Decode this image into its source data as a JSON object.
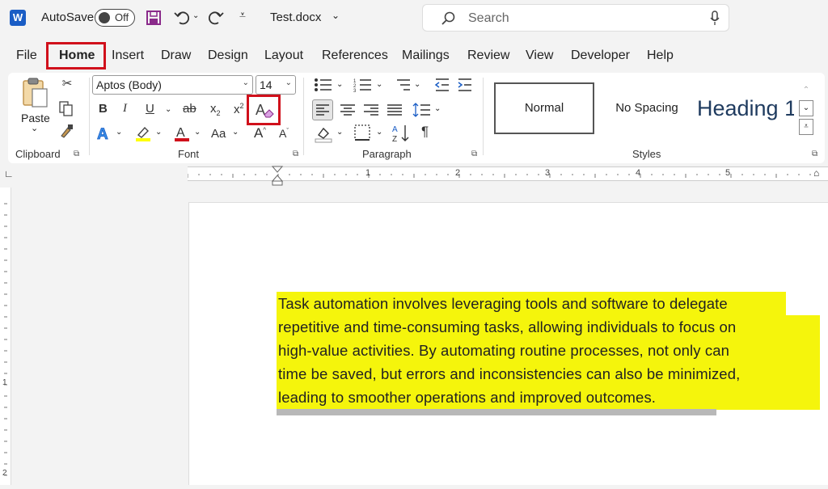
{
  "titlebar": {
    "autosave_label": "AutoSave",
    "autosave_state": "Off",
    "filename": "Test.docx",
    "search_placeholder": "Search",
    "icons": [
      "word-logo",
      "save-icon",
      "undo-icon",
      "redo-icon",
      "customize-icon",
      "search-icon",
      "mic-icon"
    ]
  },
  "menu": {
    "tabs": [
      "File",
      "Home",
      "Insert",
      "Draw",
      "Design",
      "Layout",
      "References",
      "Mailings",
      "Review",
      "View",
      "Developer",
      "Help"
    ],
    "active_tab": "Home",
    "highlight_color": "#d0101b"
  },
  "ribbon": {
    "clipboard": {
      "label": "Clipboard",
      "paste_label": "Paste"
    },
    "font": {
      "label": "Font",
      "font_name": "Aptos (Body)",
      "font_size": "14",
      "bold": "B",
      "italic": "I",
      "underline": "U",
      "strike": "ab",
      "subscript": "x",
      "subscript_small": "2",
      "superscript": "x",
      "superscript_small": "2",
      "clear_formatting": "A",
      "text_effects": "A",
      "font_color": "A",
      "change_case": "Aa",
      "grow_font": "A",
      "shrink_font": "A"
    },
    "paragraph": {
      "label": "Paragraph",
      "pilcrow": "¶"
    },
    "styles": {
      "label": "Styles",
      "normal": "Normal",
      "no_spacing": "No Spacing",
      "heading": "Heading 1"
    }
  },
  "ruler": {
    "numbers": [
      "1",
      "2",
      "3",
      "4",
      "5"
    ]
  },
  "vruler": {
    "numbers": [
      "1",
      "2"
    ]
  },
  "document": {
    "lines": [
      "Task automation involves leveraging tools and software to delegate",
      "repetitive and time-consuming tasks, allowing individuals to focus on",
      "high-value activities. By automating routine processes, not only can",
      "time be saved, but errors and inconsistencies can also be minimized,",
      "leading to smoother operations and improved outcomes."
    ],
    "highlight_color": "#f5f50c"
  }
}
